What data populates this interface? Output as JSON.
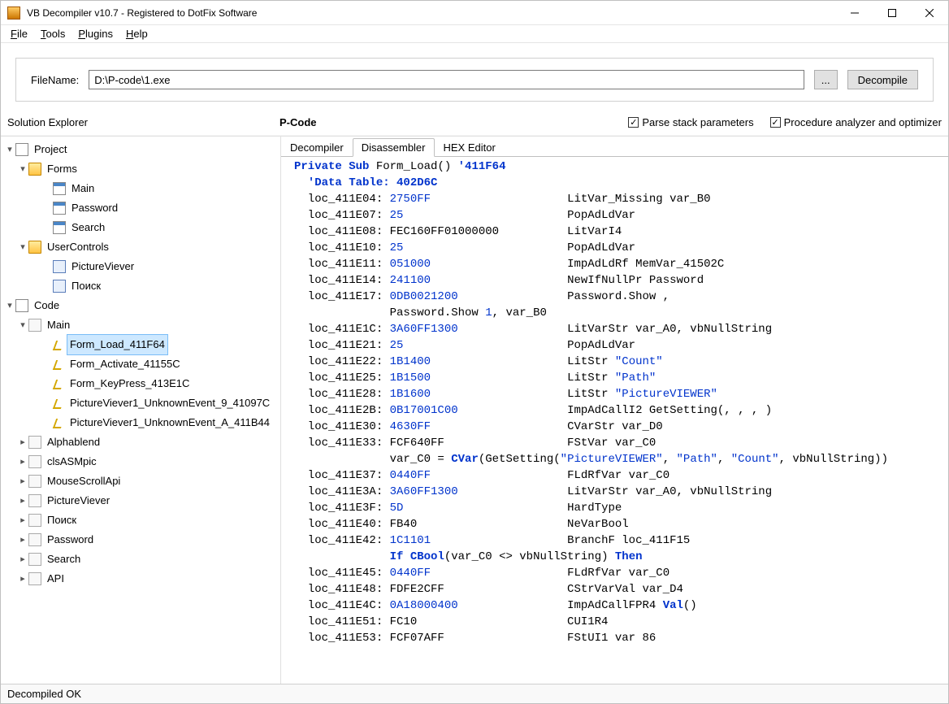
{
  "window": {
    "title": "VB Decompiler v10.7 - Registered to DotFix Software"
  },
  "menubar": {
    "file": "File",
    "tools": "Tools",
    "plugins": "Plugins",
    "help": "Help"
  },
  "toolbar": {
    "filename_label": "FileName:",
    "filename_value": "D:\\P-code\\1.exe",
    "browse": "...",
    "decompile": "Decompile"
  },
  "headers": {
    "solution_explorer": "Solution Explorer",
    "section_label": "P-Code",
    "parse_stack": "Parse stack parameters",
    "proc_analyzer": "Procedure analyzer and optimizer"
  },
  "tree": {
    "project": "Project",
    "forms": "Forms",
    "forms_items": [
      "Main",
      "Password",
      "Search"
    ],
    "usercontrols": "UserControls",
    "uc_items": [
      "PictureViever",
      "Поиск"
    ],
    "code": "Code",
    "main": "Main",
    "main_subs": [
      "Form_Load_411F64",
      "Form_Activate_41155C",
      "Form_KeyPress_413E1C",
      "PictureViever1_UnknownEvent_9_41097C",
      "PictureViever1_UnknownEvent_A_411B44"
    ],
    "code_other": [
      "Alphablend",
      "clsASMpic",
      "MouseScrollApi",
      "PictureViever",
      "Поиск",
      "Password",
      "Search"
    ],
    "api": "API"
  },
  "tabs": {
    "decompiler": "Decompiler",
    "disassembler": "Disassembler",
    "hex": "HEX Editor"
  },
  "code": {
    "header": {
      "kw1": "Private",
      "kw2": "Sub",
      "name": "Form_Load()",
      "addr": "'411F64"
    },
    "datatable": "'Data Table: 402D6C",
    "lines": [
      {
        "loc": "loc_411E04:",
        "hex": "2750FF",
        "op": "LitVar_Missing var_B0"
      },
      {
        "loc": "loc_411E07:",
        "hex": "25",
        "op": "PopAdLdVar"
      },
      {
        "loc": "loc_411E08:",
        "raw": "FEC160FF01000000",
        "op": "LitVarI4"
      },
      {
        "loc": "loc_411E10:",
        "hex": "25",
        "op": "PopAdLdVar"
      },
      {
        "loc": "loc_411E11:",
        "hex": "051000",
        "op": "ImpAdLdRf MemVar_41502C"
      },
      {
        "loc": "loc_411E14:",
        "hex": "241100",
        "op": "NewIfNullPr Password"
      },
      {
        "loc": "loc_411E17:",
        "hex": "0DB0021200",
        "op": "Password.Show ,"
      },
      {
        "cont": "Password.Show ",
        "hx": "1",
        "tail": ", var_B0"
      },
      {
        "loc": "loc_411E1C:",
        "hex": "3A60FF1300",
        "op": "LitVarStr var_A0, vbNullString"
      },
      {
        "loc": "loc_411E21:",
        "hex": "25",
        "op": "PopAdLdVar"
      },
      {
        "loc": "loc_411E22:",
        "hex": "1B1400",
        "op": "LitStr ",
        "str": "\"Count\""
      },
      {
        "loc": "loc_411E25:",
        "hex": "1B1500",
        "op": "LitStr ",
        "str": "\"Path\""
      },
      {
        "loc": "loc_411E28:",
        "hex": "1B1600",
        "op": "LitStr ",
        "str": "\"PictureVIEWER\""
      },
      {
        "loc": "loc_411E2B:",
        "hex": "0B17001C00",
        "op": "ImpAdCallI2 GetSetting(, , , )"
      },
      {
        "loc": "loc_411E30:",
        "hex": "4630FF",
        "op": "CVarStr var_D0"
      },
      {
        "loc": "loc_411E33:",
        "raw": "FCF640FF",
        "op": "FStVar var_C0"
      },
      {
        "varline": "var_C0 = ",
        "fn": "CVar",
        "post": "(GetSetting(",
        "s1": "\"PictureVIEWER\"",
        "c": ", ",
        "s2": "\"Path\"",
        "c2": ", ",
        "s3": "\"Count\"",
        "c3": ", vbNullString))"
      },
      {
        "loc": "loc_411E37:",
        "hex": "0440FF",
        "op": "FLdRfVar var_C0"
      },
      {
        "loc": "loc_411E3A:",
        "hex": "3A60FF1300",
        "op": "LitVarStr var_A0, vbNullString"
      },
      {
        "loc": "loc_411E3F:",
        "hex": "5D",
        "op": "HardType"
      },
      {
        "loc": "loc_411E40:",
        "raw": "FB40",
        "op": "NeVarBool"
      },
      {
        "loc": "loc_411E42:",
        "hex": "1C1101",
        "op": "BranchF loc_411F15"
      },
      {
        "ifline": true,
        "kw1": "If",
        "fn": "CBool",
        "mid": "(var_C0 <> vbNullString)",
        "kw2": "Then"
      },
      {
        "loc": "loc_411E45:",
        "hex": "0440FF",
        "op": "FLdRfVar var_C0"
      },
      {
        "loc": "loc_411E48:",
        "raw": "FDFE2CFF",
        "op": "CStrVarVal var_D4"
      },
      {
        "loc": "loc_411E4C:",
        "hex": "0A18000400",
        "op": "ImpAdCallFPR4 ",
        "fn2": "Val",
        "post2": "()"
      },
      {
        "loc": "loc_411E51:",
        "raw": "FC10",
        "op": "CUI1R4"
      },
      {
        "loc": "loc_411E53:",
        "raw": "FCF07AFF",
        "op": "FStUI1 var 86"
      }
    ]
  },
  "status": "Decompiled OK"
}
